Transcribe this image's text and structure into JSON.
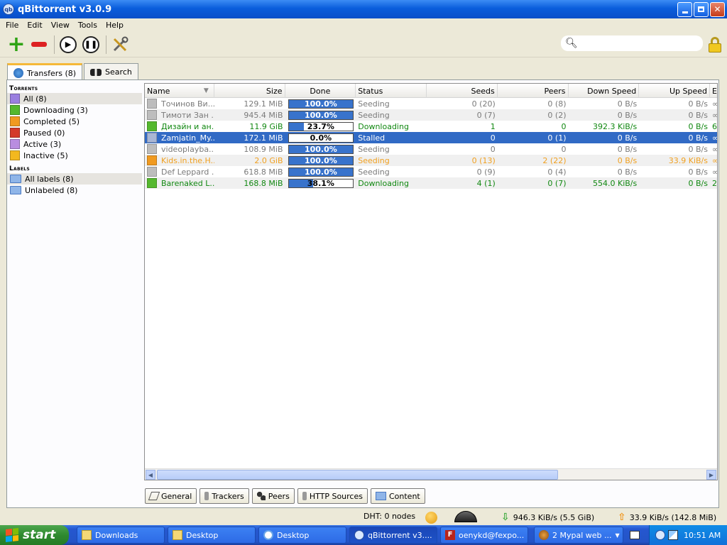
{
  "window": {
    "title": "qBittorrent v3.0.9",
    "app_icon": "qb"
  },
  "menu": [
    "File",
    "Edit",
    "View",
    "Tools",
    "Help"
  ],
  "search": {
    "placeholder": "",
    "value": ""
  },
  "main_tabs": [
    {
      "label": "Transfers (8)",
      "icon": "transfers-icon"
    },
    {
      "label": "Search",
      "icon": "binoculars-icon"
    }
  ],
  "sidebar": {
    "torrents_header": "Torrents",
    "filters": [
      {
        "label": "All (8)",
        "color": "#9a7fe0"
      },
      {
        "label": "Downloading (3)",
        "color": "#55b82e"
      },
      {
        "label": "Completed (5)",
        "color": "#f09a20"
      },
      {
        "label": "Paused (0)",
        "color": "#d33a2a"
      },
      {
        "label": "Active (3)",
        "color": "#b98de0"
      },
      {
        "label": "Inactive (5)",
        "color": "#f3b81f"
      }
    ],
    "labels_header": "Labels",
    "labels": [
      "All labels (8)",
      "Unlabeled (8)"
    ]
  },
  "table": {
    "columns": [
      "Name",
      "Size",
      "Done",
      "Status",
      "Seeds",
      "Peers",
      "Down Speed",
      "Up Speed",
      "E"
    ],
    "rows": [
      {
        "name": "Точинов Ви...",
        "size": "129.1 MiB",
        "done": 100.0,
        "done_text": "100.0%",
        "status": "Seeding",
        "seeds": "0 (20)",
        "peers": "0 (8)",
        "down": "0 B/s",
        "up": "0 B/s",
        "eta": "∞",
        "color": "#7a7a7a",
        "state": "seeding"
      },
      {
        "name": "Тимоти Зан ...",
        "size": "945.4 MiB",
        "done": 100.0,
        "done_text": "100.0%",
        "status": "Seeding",
        "seeds": "0 (7)",
        "peers": "0 (2)",
        "down": "0 B/s",
        "up": "0 B/s",
        "eta": "∞",
        "color": "#7a7a7a",
        "state": "seeding"
      },
      {
        "name": "Дизайн и ан...",
        "size": "11.9 GiB",
        "done": 23.7,
        "done_text": "23.7%",
        "status": "Downloading",
        "seeds": "1",
        "peers": "0",
        "down": "392.3 KiB/s",
        "up": "0 B/s",
        "eta": "6",
        "color": "#118811",
        "state": "downloading"
      },
      {
        "name": "Zamjatin_My...",
        "size": "172.1 MiB",
        "done": 0.0,
        "done_text": "0.0%",
        "status": "Stalled",
        "seeds": "0",
        "peers": "0 (1)",
        "down": "0 B/s",
        "up": "0 B/s",
        "eta": "∞",
        "color": "#ffffff",
        "state": "stalled"
      },
      {
        "name": "videoplayba...",
        "size": "108.9 MiB",
        "done": 100.0,
        "done_text": "100.0%",
        "status": "Seeding",
        "seeds": "0",
        "peers": "0",
        "down": "0 B/s",
        "up": "0 B/s",
        "eta": "∞",
        "color": "#7a7a7a",
        "state": "seeding"
      },
      {
        "name": "Kids.in.the.H...",
        "size": "2.0 GiB",
        "done": 100.0,
        "done_text": "100.0%",
        "status": "Seeding",
        "seeds": "0 (13)",
        "peers": "2 (22)",
        "down": "0 B/s",
        "up": "33.9 KiB/s",
        "eta": "∞",
        "color": "#f0a020",
        "state": "uploading"
      },
      {
        "name": "Def Leppard ...",
        "size": "618.8 MiB",
        "done": 100.0,
        "done_text": "100.0%",
        "status": "Seeding",
        "seeds": "0 (9)",
        "peers": "0 (4)",
        "down": "0 B/s",
        "up": "0 B/s",
        "eta": "∞",
        "color": "#7a7a7a",
        "state": "seeding"
      },
      {
        "name": "Barenaked L...",
        "size": "168.8 MiB",
        "done": 38.1,
        "done_text": "38.1%",
        "status": "Downloading",
        "seeds": "4 (1)",
        "peers": "0 (7)",
        "down": "554.0 KiB/s",
        "up": "0 B/s",
        "eta": "2",
        "color": "#118811",
        "state": "downloading"
      }
    ]
  },
  "detail_tabs": [
    "General",
    "Trackers",
    "Peers",
    "HTTP Sources",
    "Content"
  ],
  "status": {
    "dht": "DHT: 0 nodes",
    "down": "946.3 KiB/s (5.5 GiB)",
    "up": "33.9 KiB/s (142.8 MiB)"
  },
  "taskbar": {
    "start": "start",
    "buttons": [
      {
        "label": "Downloads",
        "icon": "folder-icon"
      },
      {
        "label": "Desktop",
        "icon": "folder-icon"
      },
      {
        "label": "Desktop",
        "icon": "ie-icon"
      },
      {
        "label": "qBittorrent v3....",
        "icon": "qbittorrent-icon"
      },
      {
        "label": "oenykd@fexpo...",
        "icon": "filezilla-icon"
      },
      {
        "label": "2 Mypal web ...",
        "icon": "browser-icon"
      }
    ],
    "clock": "10:51 AM"
  }
}
